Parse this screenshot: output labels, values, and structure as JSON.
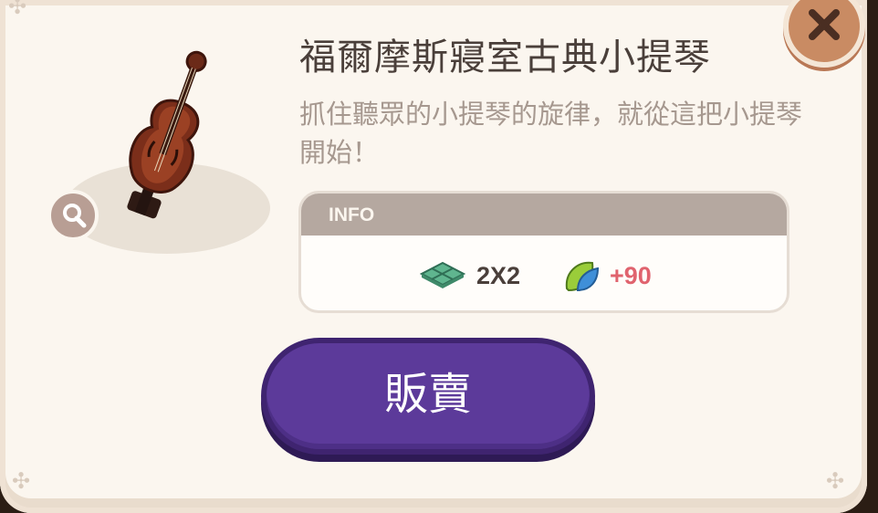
{
  "item": {
    "title": "福爾摩斯寢室古典小提琴",
    "description": "抓住聽眾的小提琴的旋律，就從這把小提琴開始！",
    "image_icon": "violin-on-stand"
  },
  "info": {
    "header": "INFO",
    "size_value": "2X2",
    "score_value": "+90"
  },
  "actions": {
    "sell_label": "販賣",
    "close_icon": "close-x",
    "zoom_icon": "magnifier"
  },
  "colors": {
    "sell_button": "#5c3a9a",
    "score_text": "#e0636e",
    "close_button": "#c98b63"
  }
}
